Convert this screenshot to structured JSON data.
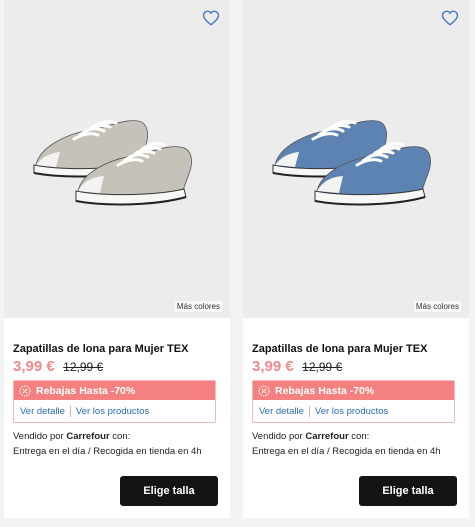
{
  "products": [
    {
      "name": "Zapatillas de lona para Mujer TEX",
      "price": "3,99 €",
      "old_price": "12,99 €",
      "more_colors": "Más colores",
      "promo": "Rebajas Hasta -70%",
      "link_detail": "Ver detalle",
      "link_products": "Ver los productos",
      "seller_prefix": "Vendido por ",
      "seller_name": "Carrefour",
      "seller_suffix": " con:",
      "delivery": "Entrega en el día /  Recogida en tienda en 4h",
      "button": "Elige talla",
      "shoe_color": "#c6c2ba",
      "favorite_icon": "heart-outline-icon"
    },
    {
      "name": "Zapatillas de lona para Mujer TEX",
      "price": "3,99 €",
      "old_price": "12,99 €",
      "more_colors": "Más colores",
      "promo": "Rebajas Hasta -70%",
      "link_detail": "Ver detalle",
      "link_products": "Ver los productos",
      "seller_prefix": "Vendido por ",
      "seller_name": "Carrefour",
      "seller_suffix": " con:",
      "delivery": "Entrega en el día /  Recogida en tienda en 4h",
      "button": "Elige talla",
      "shoe_color": "#5d83b3",
      "favorite_icon": "heart-outline-icon"
    }
  ],
  "colors": {
    "price": "#f08a8e",
    "promo_bg": "#f4817f",
    "link": "#2b6bb8",
    "button_bg": "#141414",
    "icon_blue": "#3b74c4"
  }
}
